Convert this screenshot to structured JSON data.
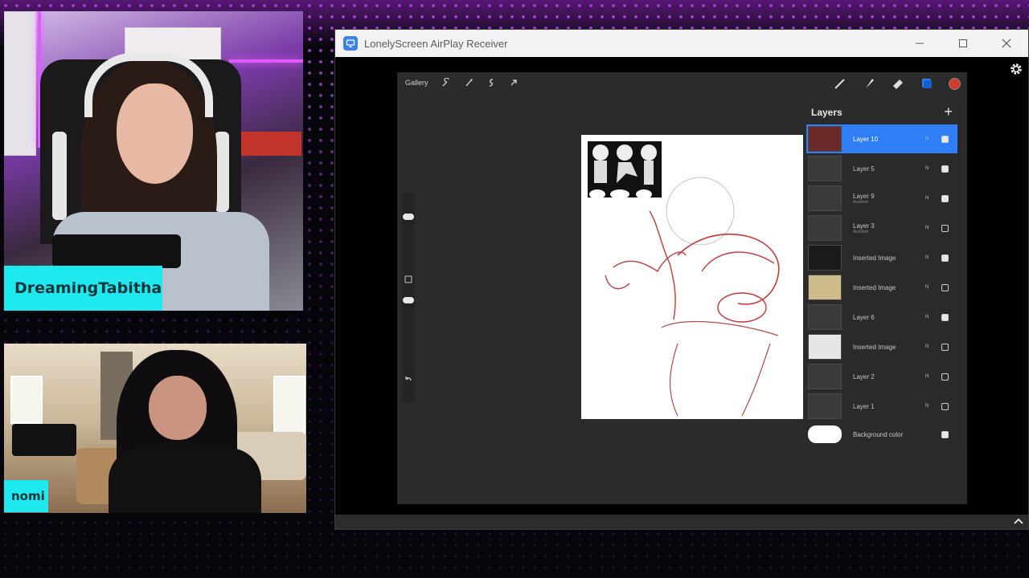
{
  "stream": {
    "webcams": [
      {
        "name_tag": "DreamingTabitha"
      },
      {
        "name_tag": "nomi"
      }
    ],
    "colors": {
      "name_tag_bg": "#1de9ef",
      "background_dots": "#d25aff"
    }
  },
  "window": {
    "title": "LonelyScreen AirPlay Receiver",
    "icon": "airplay-app-icon",
    "controls": [
      "minimize-icon",
      "maximize-icon",
      "close-icon"
    ]
  },
  "procreate": {
    "toolbar": {
      "gallery_label": "Gallery",
      "left_tools": [
        "wrench-icon",
        "magic-wand-icon",
        "selection-icon",
        "transform-arrow-icon"
      ],
      "right_tools": [
        "brush-icon",
        "smudge-icon",
        "eraser-icon",
        "layers-icon",
        "color-icon"
      ]
    },
    "layers_panel": {
      "title": "Layers",
      "add_label": "+",
      "layers": [
        {
          "name": "Layer 10",
          "sub": "",
          "mode": "N",
          "visible": true,
          "active": true
        },
        {
          "name": "Layer 5",
          "sub": "",
          "mode": "N",
          "visible": true,
          "active": false
        },
        {
          "name": "Layer 9",
          "sub": "Assisted",
          "mode": "N",
          "visible": true,
          "active": false
        },
        {
          "name": "Layer 3",
          "sub": "Assisted",
          "mode": "N",
          "visible": false,
          "active": false
        },
        {
          "name": "Inserted Image",
          "sub": "",
          "mode": "N",
          "visible": true,
          "active": false
        },
        {
          "name": "Inserted Image",
          "sub": "",
          "mode": "N",
          "visible": false,
          "active": false
        },
        {
          "name": "Layer 6",
          "sub": "",
          "mode": "N",
          "visible": true,
          "active": false
        },
        {
          "name": "Inserted Image",
          "sub": "",
          "mode": "N",
          "visible": false,
          "active": false
        },
        {
          "name": "Layer 2",
          "sub": "",
          "mode": "N",
          "visible": false,
          "active": false
        },
        {
          "name": "Layer 1",
          "sub": "",
          "mode": "N",
          "visible": false,
          "active": false
        }
      ],
      "background": {
        "name": "Background color",
        "visible": true
      }
    }
  }
}
